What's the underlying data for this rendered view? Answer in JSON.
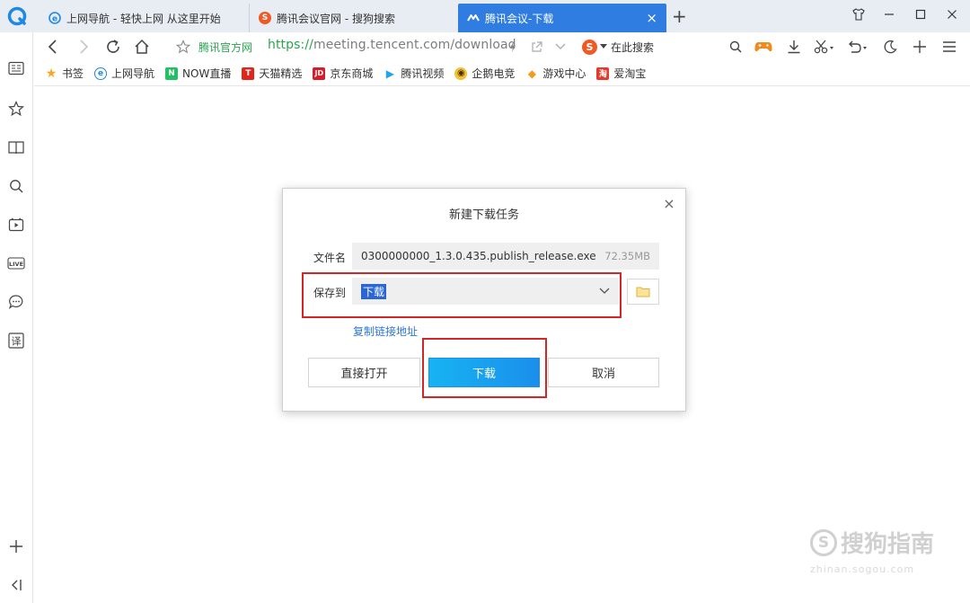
{
  "tabs": [
    {
      "label": "上网导航 - 轻快上网 从这里开始",
      "icon": "ie-e-icon",
      "active": false
    },
    {
      "label": "腾讯会议官网 - 搜狗搜索",
      "icon": "sogou-icon",
      "active": false
    },
    {
      "label": "腾讯会议-下载",
      "icon": "tencent-meeting-icon",
      "active": true
    }
  ],
  "tab_close": "×",
  "new_tab": "+",
  "address_bar": {
    "site_name": "腾讯官方网",
    "url_scheme": "https://",
    "url_rest": "meeting.tencent.com/download",
    "search_placeholder": "在此搜索",
    "search_logo": "S"
  },
  "bookmarks": [
    {
      "label": "书签",
      "icon": "star-icon",
      "color": "#f5a623",
      "glyph": "★"
    },
    {
      "label": "上网导航",
      "icon": "ie-e-icon",
      "color": "#1e88e5",
      "glyph": "e"
    },
    {
      "label": "NOW直播",
      "icon": "now-live-icon",
      "color": "#20c063",
      "glyph": "N"
    },
    {
      "label": "天猫精选",
      "icon": "tmall-icon",
      "color": "#e1251b",
      "glyph": "T"
    },
    {
      "label": "京东商城",
      "icon": "jd-icon",
      "color": "#d71d2b",
      "glyph": "JD"
    },
    {
      "label": "腾讯视频",
      "icon": "tencent-video-icon",
      "color": "#20a5ec",
      "glyph": "▶"
    },
    {
      "label": "企鹅电竞",
      "icon": "penguin-esports-icon",
      "color": "#8a5a00",
      "glyph": "◉"
    },
    {
      "label": "游戏中心",
      "icon": "game-center-icon",
      "color": "#f59b1a",
      "glyph": "◆"
    },
    {
      "label": "爱淘宝",
      "icon": "ai-taobao-icon",
      "color": "#e6382c",
      "glyph": "淘"
    }
  ],
  "dialog": {
    "title": "新建下载任务",
    "close": "×",
    "filename_label": "文件名",
    "filename": "0300000000_1.3.0.435.publish_release.exe",
    "filesize": "72.35MB",
    "saveto_label": "保存到",
    "saveto_value": "下载",
    "copy_link": "复制链接地址",
    "open_direct": "直接打开",
    "download": "下载",
    "cancel": "取消"
  },
  "watermark": {
    "text": "搜狗指南",
    "url": "zhinan.sogou.com"
  },
  "colors": {
    "accent": "#2f7de0",
    "primary_button": "#1a8fec",
    "highlight": "#d42626",
    "link": "#2d75d6",
    "site_green": "#2aa44f"
  }
}
